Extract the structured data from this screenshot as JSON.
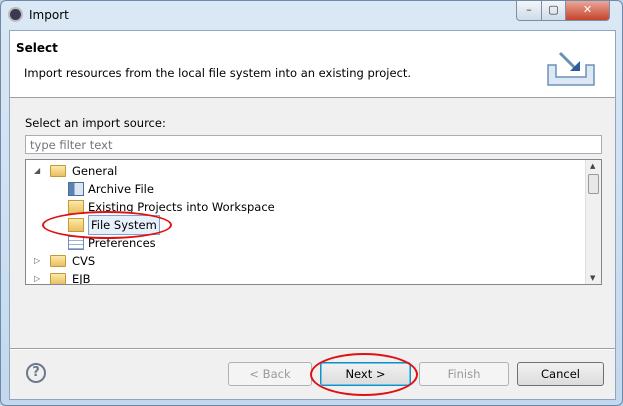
{
  "window": {
    "title": "Import",
    "controls": [
      "minimize",
      "maximize",
      "close"
    ]
  },
  "header": {
    "title": "Select",
    "description": "Import resources from the local file system into an existing project.",
    "icon": "import-wizard-icon"
  },
  "source": {
    "label": "Select an import source:",
    "filter_placeholder": "type filter text"
  },
  "tree": {
    "items": [
      {
        "label": "General",
        "expanded": true,
        "icon": "folder-icon"
      },
      {
        "label": "Archive File",
        "icon": "archive-icon"
      },
      {
        "label": "Existing Projects into Workspace",
        "icon": "project-folder-icon"
      },
      {
        "label": "File System",
        "icon": "folder-icon",
        "selected": true
      },
      {
        "label": "Preferences",
        "icon": "preferences-icon"
      },
      {
        "label": "CVS",
        "expanded": false,
        "icon": "folder-icon"
      },
      {
        "label": "EJB",
        "expanded": false,
        "icon": "folder-icon"
      }
    ]
  },
  "buttons": {
    "back": "< Back",
    "next": "Next >",
    "finish": "Finish",
    "cancel": "Cancel",
    "help": "?"
  },
  "annotation_color": "#e01010"
}
